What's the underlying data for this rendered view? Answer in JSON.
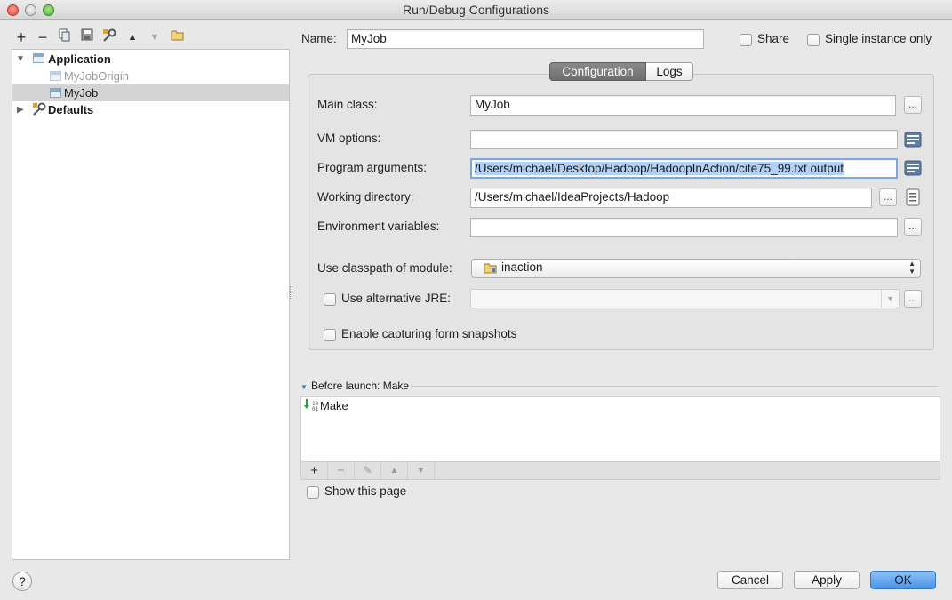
{
  "window": {
    "title": "Run/Debug Configurations"
  },
  "toolbar": {
    "icons": [
      "add-icon",
      "remove-icon",
      "copy-icon",
      "save-icon",
      "edit-defaults-icon",
      "move-up-icon",
      "move-down-icon",
      "folder-icon"
    ],
    "add_glyph": "+",
    "remove_glyph": "−"
  },
  "tree": {
    "application_label": "Application",
    "items": [
      {
        "label": "MyJobOrigin",
        "selected": false
      },
      {
        "label": "MyJob",
        "selected": true
      }
    ],
    "defaults_label": "Defaults"
  },
  "header": {
    "name_label": "Name:",
    "name_value": "MyJob",
    "share_label": "Share",
    "single_instance_label": "Single instance only"
  },
  "tabs": [
    {
      "label": "Configuration",
      "active": true
    },
    {
      "label": "Logs",
      "active": false
    }
  ],
  "form": {
    "main_class_label": "Main class:",
    "main_class_value": "MyJob",
    "vm_options_label": "VM options:",
    "vm_options_value": "",
    "program_args_label": "Program arguments:",
    "program_args_value": "/Users/michael/Desktop/Hadoop/HadoopInAction/cite75_99.txt output",
    "working_dir_label": "Working directory:",
    "working_dir_value": "/Users/michael/IdeaProjects/Hadoop",
    "env_vars_label": "Environment variables:",
    "env_vars_value": "",
    "classpath_label": "Use classpath of module:",
    "classpath_value": "inaction",
    "alt_jre_label": "Use alternative JRE:",
    "alt_jre_value": "",
    "snapshots_label": "Enable capturing form snapshots",
    "ellipsis": "..."
  },
  "before_launch": {
    "title": "Before launch: Make",
    "items": [
      "Make"
    ],
    "tools": [
      "+",
      "−",
      "✎",
      "▲",
      "▼"
    ]
  },
  "show_page_label": "Show this page",
  "buttons": {
    "help": "?",
    "cancel": "Cancel",
    "apply": "Apply",
    "ok": "OK"
  },
  "colors": {
    "selection": "#b3d0f5",
    "primary": "#4a93e6"
  }
}
